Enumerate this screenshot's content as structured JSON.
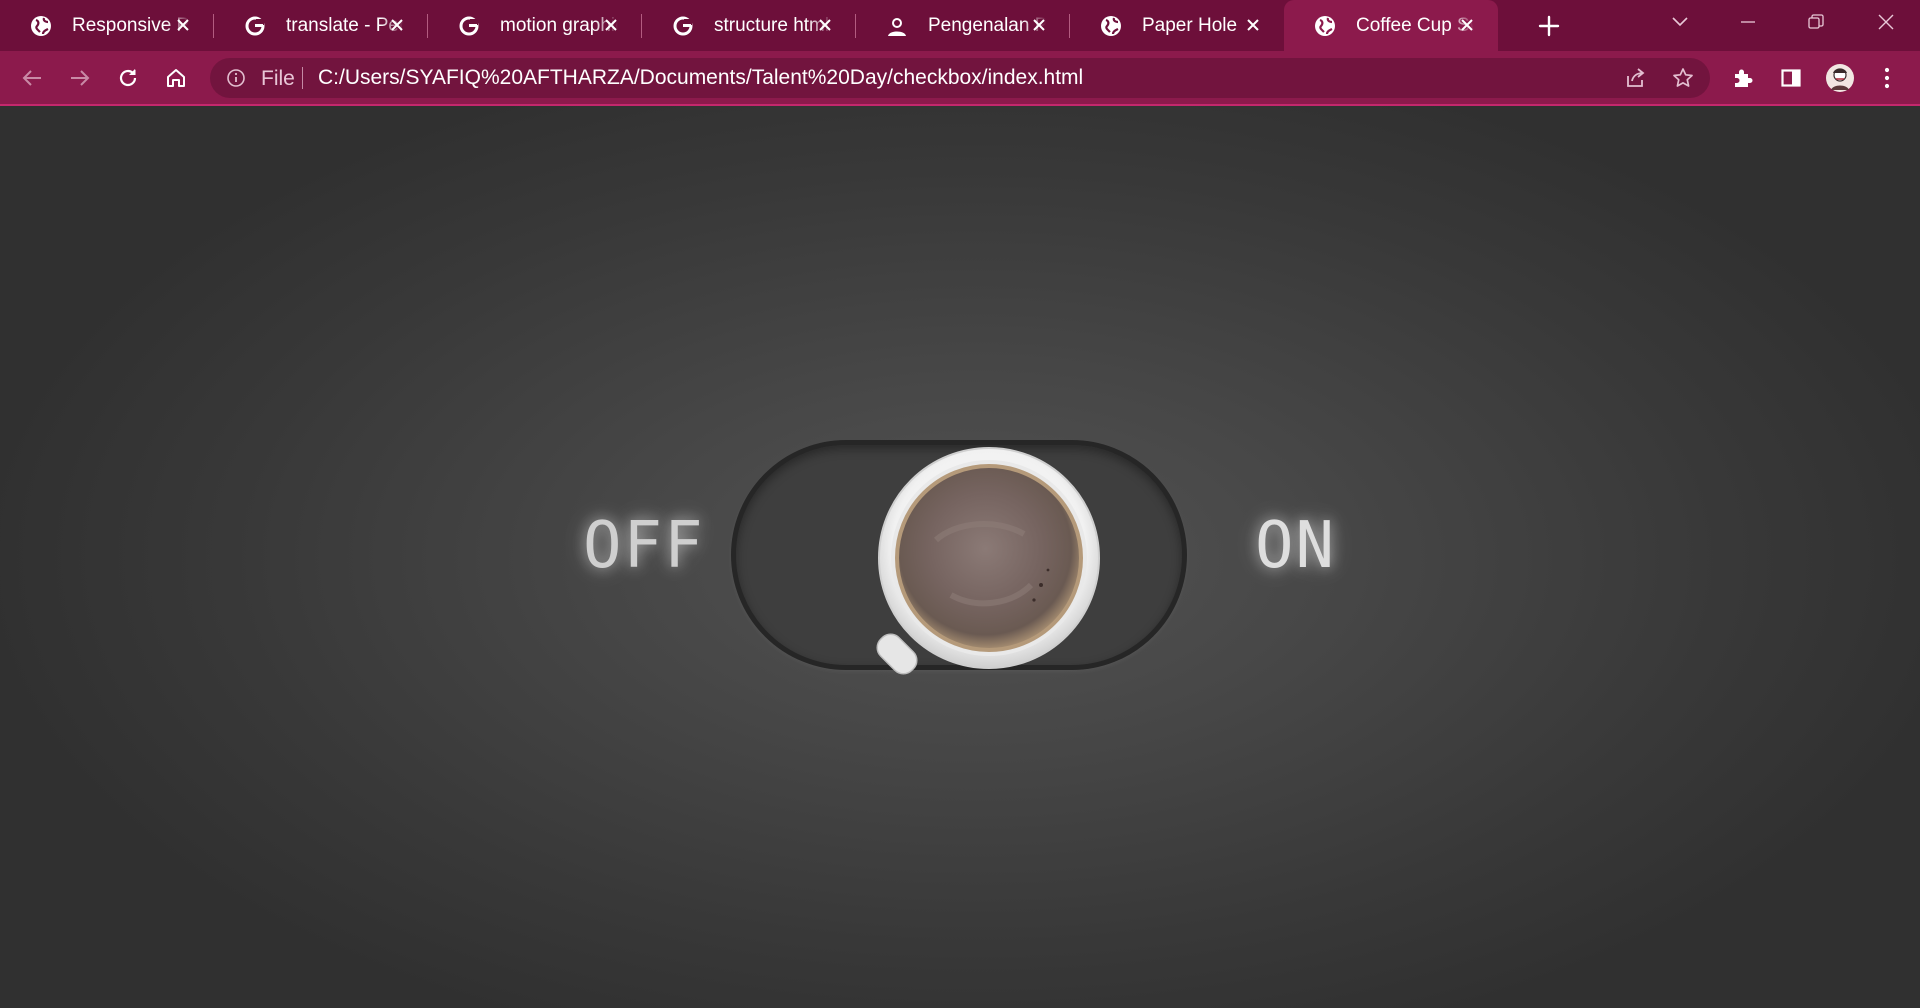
{
  "tabs": [
    {
      "title": "Responsive Per",
      "favicon": "globe-icon"
    },
    {
      "title": "translate - Penc",
      "favicon": "google-g-icon"
    },
    {
      "title": "motion graphic",
      "favicon": "google-g-icon"
    },
    {
      "title": "structure html",
      "favicon": "google-g-icon"
    },
    {
      "title": "Pengenalan Pr",
      "favicon": "avatar-icon"
    },
    {
      "title": "Paper Hole",
      "favicon": "globe-icon"
    },
    {
      "title": "Coffee Cup Sw",
      "favicon": "globe-icon",
      "active": true
    }
  ],
  "omnibox": {
    "scheme": "File",
    "url": "C:/Users/SYAFIQ%20AFTHARZA/Documents/Talent%20Day/checkbox/index.html"
  },
  "toggle": {
    "off_label": "OFF",
    "on_label": "ON",
    "state": "off"
  },
  "colors": {
    "tabstrip": "#6d0f3a",
    "toolbar": "#8c1a4c",
    "accent_line": "#c4286d",
    "page_background": "#474747"
  }
}
